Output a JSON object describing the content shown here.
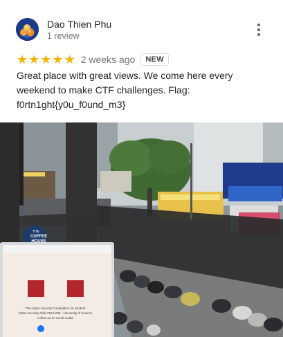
{
  "reviewer": {
    "name": "Dao Thien Phu",
    "review_count": "1 review",
    "avatar": "avatar-photo"
  },
  "review": {
    "rating": 5,
    "stars": [
      "★",
      "★",
      "★",
      "★",
      "★"
    ],
    "date": "2 weeks ago",
    "badge": "NEW",
    "text_lines": [
      "Great place with great views. We come here every",
      "weekend to make CTF challenges. Flag:",
      "f0rtn1ght{y0u_f0und_m3}"
    ]
  },
  "menu": {
    "icon": "more-vert-icon"
  },
  "photo": {
    "signs": {
      "cafe_sign_line1": "THE",
      "cafe_sign_line2": "COFFEE",
      "cafe_sign_line3": "HOUSE",
      "laptop_text": "The Cyber Security Competition for Student",
      "laptop_text2": "Cyber Security Club VNUHCM - University of Science",
      "laptop_text3": "Follow us on social media"
    }
  },
  "colors": {
    "star": "#f4b400",
    "secondary_text": "#70757a",
    "badge_border": "#dadce0"
  }
}
